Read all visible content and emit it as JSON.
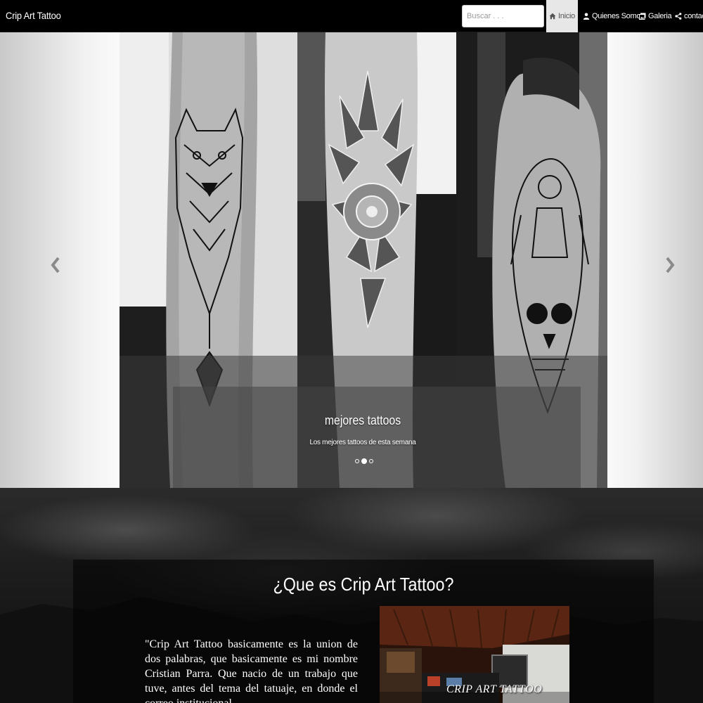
{
  "brand": "Crip Art Tattoo",
  "search": {
    "placeholder": "Buscar . . ."
  },
  "nav": {
    "inicio": "Inicio",
    "quienes": "Quienes Somos",
    "galeria": "Galeria",
    "contacto": "contacte"
  },
  "carousel": {
    "caption_title": "mejores tattoos",
    "caption_text": "Los mejores tattoos de esta semana",
    "slide_count": 3,
    "active_slide": 2
  },
  "about": {
    "title": "¿Que es Crip Art Tattoo?",
    "text": "\"Crip Art Tattoo basicamente es la union de dos palabras, que basicamente es mi nombre Cristian Parra. Que nacio de un trabajo que tuve, antes del tema del tatuaje, en donde el correo institucional",
    "photo_sign": "CRIP ART TATTOO"
  },
  "icons": {
    "home": "home-icon",
    "user": "user-icon",
    "gallery": "gallery-icon",
    "share": "share-icon",
    "prev": "chevron-left-icon",
    "next": "chevron-right-icon"
  }
}
